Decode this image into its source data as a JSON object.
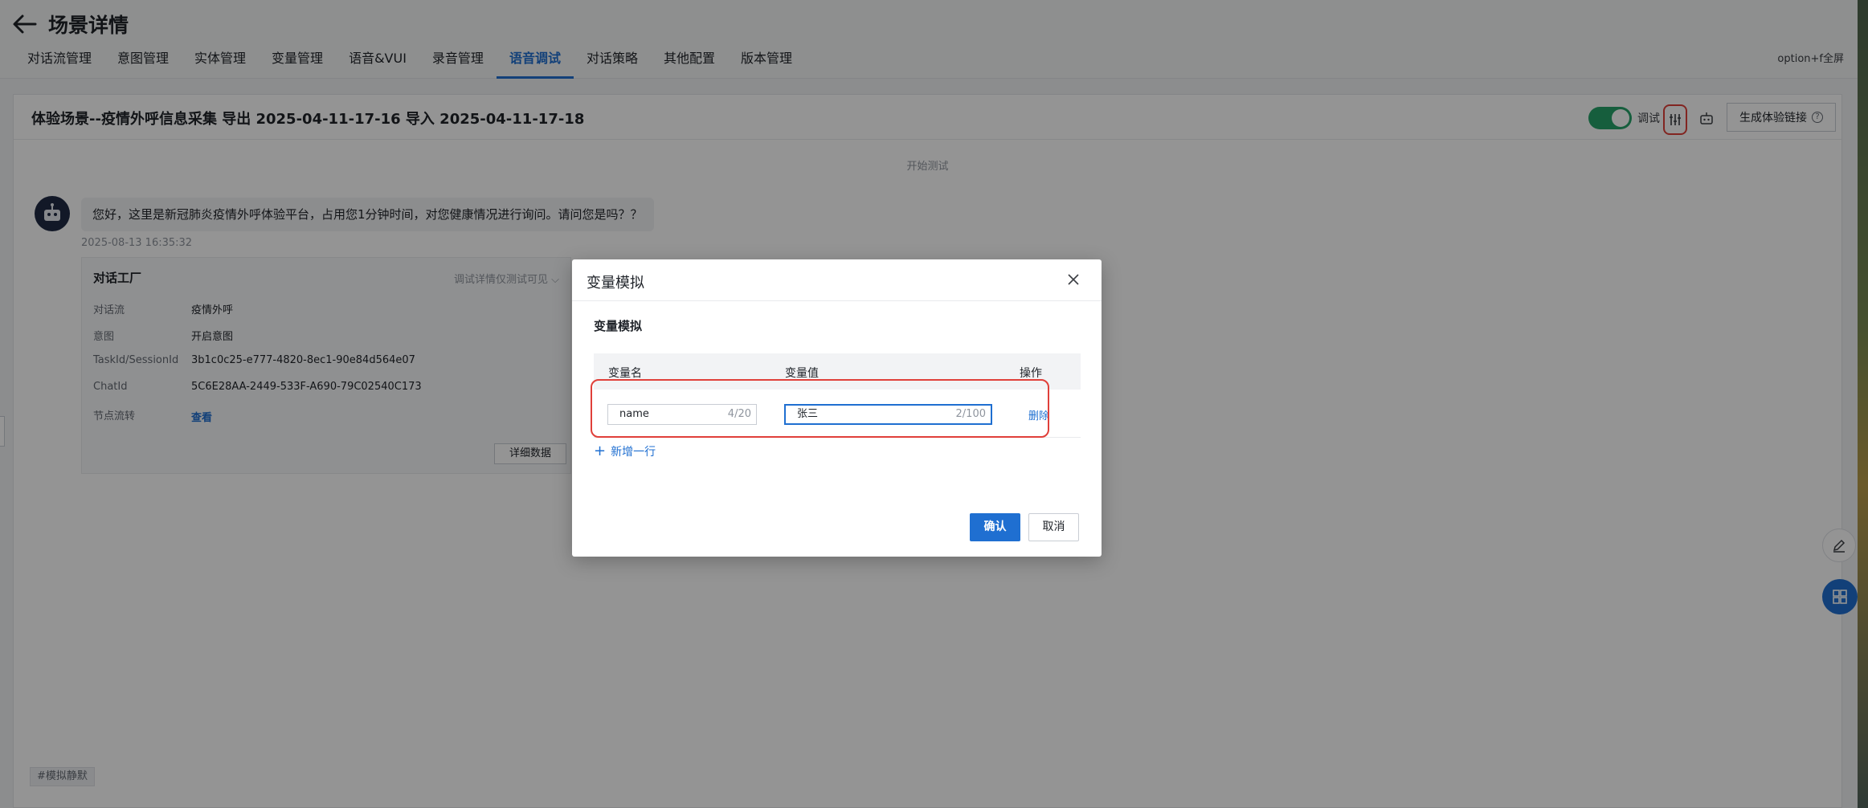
{
  "header": {
    "title": "场景详情",
    "fullscreen_hint": "option+f全屏",
    "tabs": [
      {
        "label": "对话流管理"
      },
      {
        "label": "意图管理"
      },
      {
        "label": "实体管理"
      },
      {
        "label": "变量管理"
      },
      {
        "label": "语音&VUI"
      },
      {
        "label": "录音管理"
      },
      {
        "label": "语音调试",
        "active": true
      },
      {
        "label": "对话策略"
      },
      {
        "label": "其他配置"
      },
      {
        "label": "版本管理"
      }
    ]
  },
  "scene": {
    "title": "体验场景--疫情外呼信息采集 导出 2025-04-11-17-16 导入 2025-04-11-17-18",
    "toggle_label": "调试",
    "toggle_on": true,
    "generate_link_label": "生成体验链接",
    "icons": [
      "variable-sim-icon",
      "robot-icon",
      "help-icon"
    ]
  },
  "chat": {
    "start_label": "开始测试",
    "bot_message": "您好，这里是新冠肺炎疫情外呼体验平台，占用您1分钟时间，对您健康情况进行询问。请问您是吗？？",
    "timestamp": "2025-08-13 16:35:32",
    "detail": {
      "title": "对话工厂",
      "hint": "调试详情仅测试可见",
      "rows": [
        {
          "label": "对话流",
          "value": "疫情外呼"
        },
        {
          "label": "意图",
          "value": "开启意图"
        },
        {
          "label": "TaskId/SessionId",
          "value": "3b1c0c25-e777-4820-8ec1-90e84d564e07"
        },
        {
          "label": "ChatId",
          "value": "5C6E28AA-2449-533F-A690-79C02540C173"
        },
        {
          "label": "节点流转",
          "value": "查看"
        }
      ],
      "detail_data_button": "详细数据"
    },
    "silence_tag": "#模拟静默"
  },
  "modal": {
    "title": "变量模拟",
    "section_title": "变量模拟",
    "columns": [
      "变量名",
      "变量值",
      "操作"
    ],
    "rows": [
      {
        "name": "name",
        "name_count": "4/20",
        "value": "张三",
        "value_count": "2/100",
        "action": "删除"
      }
    ],
    "add_row_label": "新增一行",
    "confirm_label": "确认",
    "cancel_label": "取消"
  },
  "colors": {
    "accent": "#1f6fd1",
    "toggle_on": "#26a269",
    "highlight": "#e0403a"
  }
}
